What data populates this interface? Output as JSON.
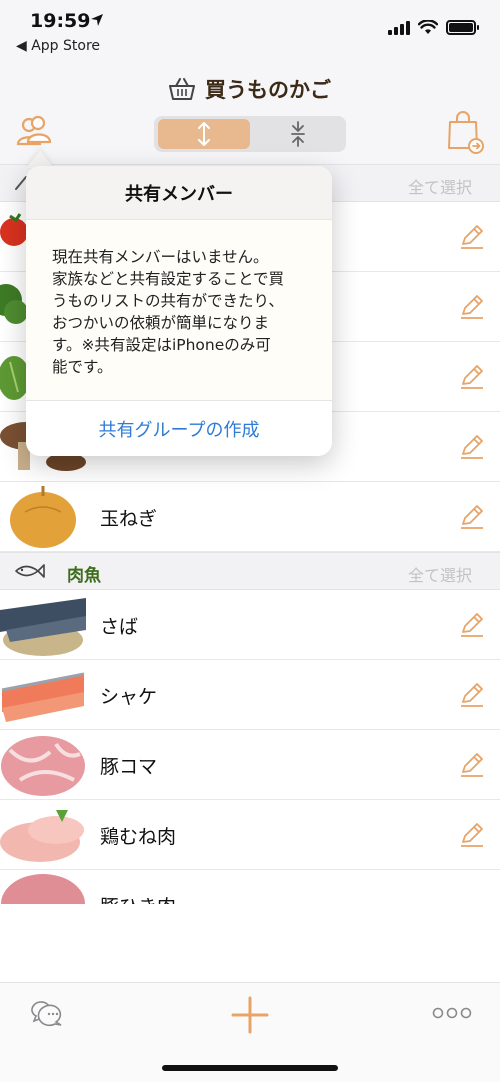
{
  "status_bar": {
    "time": "19:59",
    "back_label": "◀ App Store"
  },
  "nav": {
    "title": "買うものかご"
  },
  "colors": {
    "accent": "#e8a466",
    "section_title": "#3f6d1d",
    "link_blue": "#2f7bd6"
  },
  "sections": [
    {
      "title": "",
      "select_label": "全て選択",
      "icon": "pencil-icon",
      "items": [
        {
          "label": "",
          "thumb": "tomato"
        },
        {
          "label": "",
          "thumb": "broccoli"
        },
        {
          "label": "",
          "thumb": "lettuce"
        },
        {
          "label": "",
          "thumb": "shiitake"
        },
        {
          "label": "玉ねぎ",
          "thumb": "onion"
        }
      ]
    },
    {
      "title": "肉魚",
      "select_label": "全て選択",
      "icon": "fish-icon",
      "items": [
        {
          "label": "さば",
          "thumb": "mackerel"
        },
        {
          "label": "シャケ",
          "thumb": "salmon"
        },
        {
          "label": "豚コマ",
          "thumb": "pork"
        },
        {
          "label": "鶏むね肉",
          "thumb": "chicken"
        },
        {
          "label": "豚ひき肉",
          "thumb": "minced-pork"
        }
      ]
    }
  ],
  "popover": {
    "title": "共有メンバー",
    "body": "現在共有メンバーはいません。\n家族などと共有設定することで買\nうものリストの共有ができたり、\nおつかいの依頼が簡単になりま\nす。※共有設定はiPhoneのみ可\n能です。",
    "action_label": "共有グループの作成"
  }
}
